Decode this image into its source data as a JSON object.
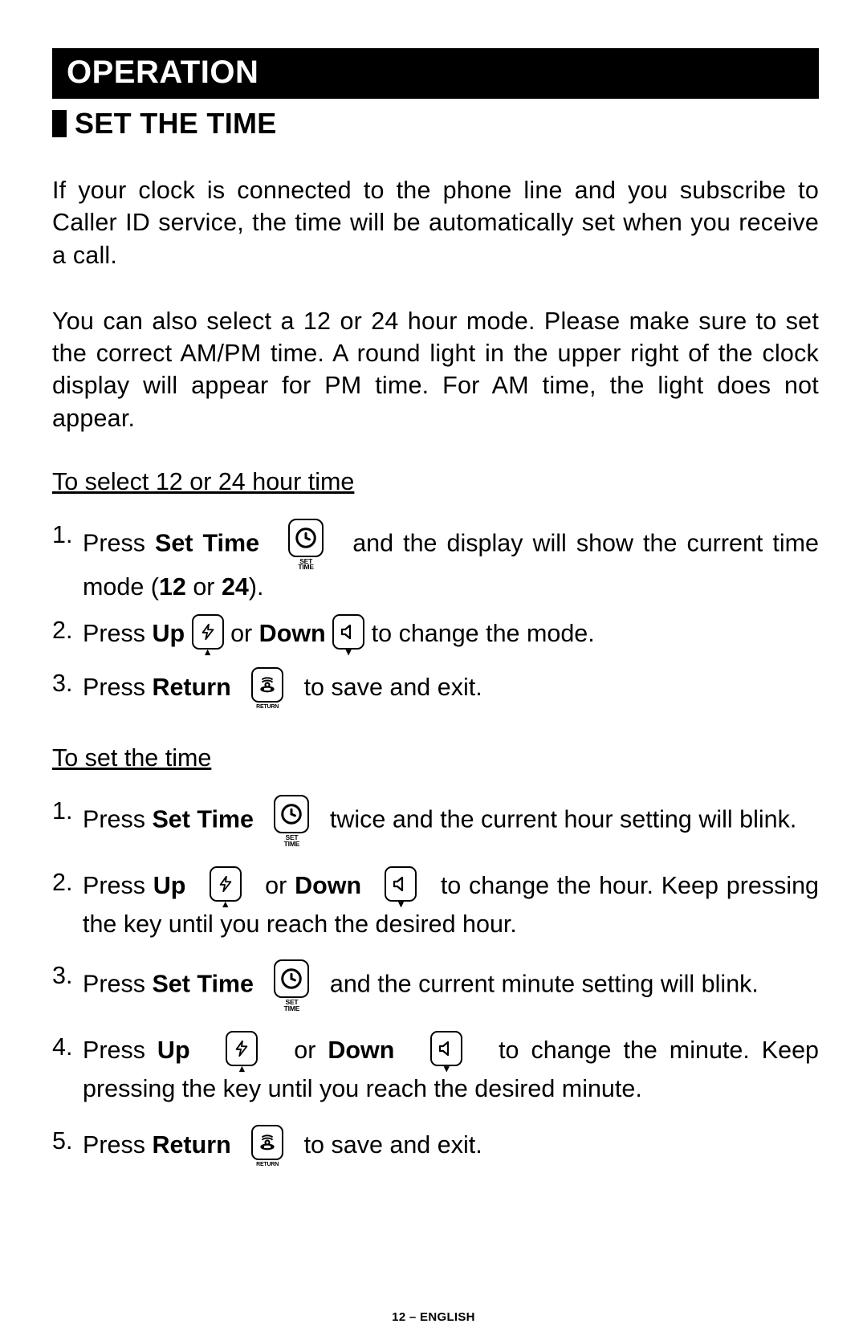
{
  "header": {
    "title": "OPERATION"
  },
  "section": {
    "title": "SET THE TIME"
  },
  "intro1": "If your clock is connected to the phone line and you subscribe to Caller ID service, the time will be automatically set when you receive a call.",
  "intro2": "You can also select a 12 or 24 hour mode.  Please make sure to set the correct AM/PM time.  A round light in the upper right of the clock display will appear for PM time.  For AM time, the light does not appear.",
  "sub1": "To select 12 or 24 hour time",
  "a1_a": "Press ",
  "a1_bold": "Set  Time",
  "a1_b": " and the display will show the current time mode (",
  "a1_twelve": "12",
  "a1_or": " or ",
  "a1_twentyfour": "24",
  "a1_end": ").",
  "a2_a": "Press ",
  "a2_up": "Up",
  "a2_mid": " or ",
  "a2_down": "Down",
  "a2_b": " to change the mode.",
  "a3_a": "Press ",
  "a3_bold": "Return",
  "a3_b": " to save and exit.",
  "sub2": "To set the time",
  "b1_a": "Press  ",
  "b1_bold": "Set  Time",
  "b1_b": "  twice   and   the   current   hour setting will blink.",
  "b2_a": "Press  ",
  "b2_up": "Up",
  "b2_mid": "   or   ",
  "b2_down": "Down",
  "b2_b": "   to  change  the  hour.  Keep pressing the key until you reach the desired hour.",
  "b3_a": "Press  ",
  "b3_bold": "Set  Time",
  "b3_b": "  and  the  current  minute  setting  will blink.",
  "b4_a": "Press  ",
  "b4_up": "Up",
  "b4_mid": "   or   ",
  "b4_down": "Down",
  "b4_b": "   to  change  the  minute.  Keep pressing the key until you reach the desired minute.",
  "b5_a": "Press ",
  "b5_bold": "Return",
  "b5_b": " to save and exit.",
  "icon_labels": {
    "set1": "SET",
    "set2": "TIME",
    "return": "RETURN"
  },
  "footer": "12 – ENGLISH"
}
